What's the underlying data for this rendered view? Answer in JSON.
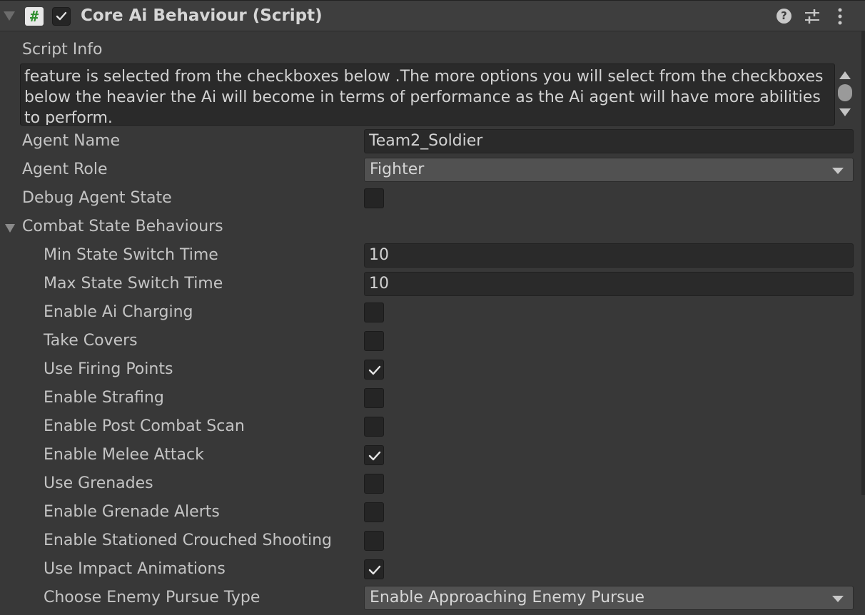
{
  "header": {
    "title": "Core Ai Behaviour (Script)",
    "enabled": true,
    "hash_glyph": "#",
    "help_glyph": "?"
  },
  "script_info": {
    "label": "Script Info",
    "text": "feature is selected from the checkboxes below .The more options you will select from the checkboxes below the heavier the Ai will become in terms of performance as the Ai agent will have more abilities to perform."
  },
  "agent_name": {
    "label": "Agent Name",
    "value": "Team2_Soldier"
  },
  "agent_role": {
    "label": "Agent Role",
    "value": "Fighter"
  },
  "debug_agent_state": {
    "label": "Debug Agent State",
    "checked": false
  },
  "combat": {
    "label": "Combat State Behaviours",
    "min_switch": {
      "label": "Min State Switch Time",
      "value": "10"
    },
    "max_switch": {
      "label": "Max State Switch Time",
      "value": "10"
    },
    "toggles": [
      {
        "label": "Enable Ai Charging",
        "checked": false
      },
      {
        "label": "Take Covers",
        "checked": false
      },
      {
        "label": "Use Firing Points",
        "checked": true
      },
      {
        "label": "Enable Strafing",
        "checked": false
      },
      {
        "label": "Enable Post Combat Scan",
        "checked": false
      },
      {
        "label": "Enable Melee Attack",
        "checked": true
      },
      {
        "label": "Use Grenades",
        "checked": false
      },
      {
        "label": "Enable Grenade Alerts",
        "checked": false
      },
      {
        "label": "Enable Stationed Crouched Shooting",
        "checked": false
      },
      {
        "label": "Use Impact Animations",
        "checked": true
      }
    ],
    "pursue_type": {
      "label": "Choose Enemy Pursue Type",
      "value": "Enable Approaching Enemy Pursue"
    }
  },
  "colors": {
    "background": "#383838",
    "header": "#3e3e3e",
    "field": "#2a2a2a",
    "dropdown": "#515151",
    "script_icon_green": "#2f8f2f"
  }
}
